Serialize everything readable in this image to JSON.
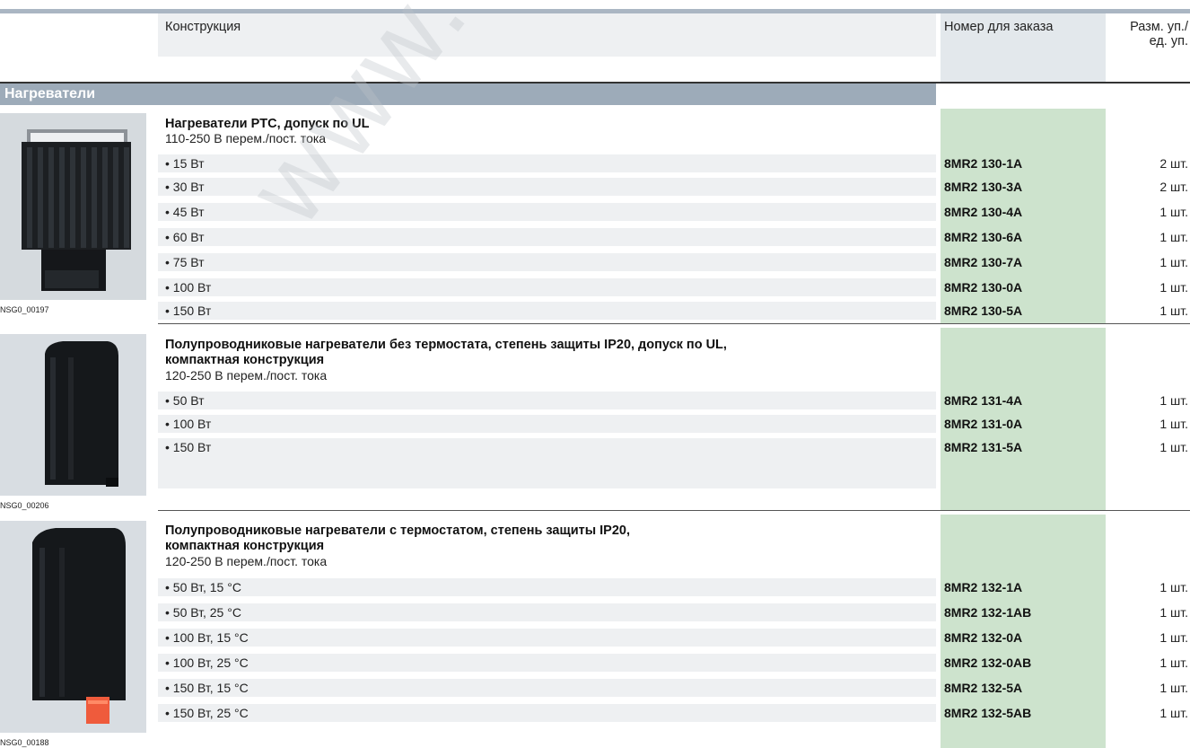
{
  "header": {
    "col_design": "Конструкция",
    "col_order": "Номер для заказа",
    "col_pack_line1": "Разм. уп./",
    "col_pack_line2": "ед. уп."
  },
  "section": {
    "title": "Нагреватели"
  },
  "watermark": "www.TESLI.com",
  "groups": [
    {
      "title_line1": "Нагреватели PTC, допуск по UL",
      "title_line2": "",
      "subtitle": "110-250 В перем./пост. тока",
      "photo_caption": "NSG0_00197",
      "rows": [
        {
          "label": "• 15 Вт",
          "order": "8MR2 130-1A",
          "qty": "2 шт."
        },
        {
          "label": "• 30 Вт",
          "order": "8MR2 130-3A",
          "qty": "2 шт."
        },
        {
          "label": "• 45 Вт",
          "order": "8MR2 130-4A",
          "qty": "1 шт."
        },
        {
          "label": "• 60 Вт",
          "order": "8MR2 130-6A",
          "qty": "1 шт."
        },
        {
          "label": "• 75 Вт",
          "order": "8MR2 130-7A",
          "qty": "1 шт."
        },
        {
          "label": "• 100 Вт",
          "order": "8MR2 130-0A",
          "qty": "1 шт."
        },
        {
          "label": "• 150 Вт",
          "order": "8MR2 130-5A",
          "qty": "1 шт."
        }
      ]
    },
    {
      "title_line1": "Полупроводниковые нагреватели без термостата, степень защиты IP20, допуск по UL,",
      "title_line2": "компактная конструкция",
      "subtitle": "120-250 В перем./пост. тока",
      "photo_caption": "NSG0_00206",
      "rows": [
        {
          "label": "• 50 Вт",
          "order": "8MR2 131-4A",
          "qty": "1 шт."
        },
        {
          "label": "• 100 Вт",
          "order": "8MR2 131-0A",
          "qty": "1 шт."
        },
        {
          "label": "• 150 Вт",
          "order": "8MR2 131-5A",
          "qty": "1 шт."
        }
      ]
    },
    {
      "title_line1": "Полупроводниковые нагреватели с термостатом, степень защиты IP20,",
      "title_line2": "компактная конструкция",
      "subtitle": "120-250 В перем./пост. тока",
      "photo_caption": "NSG0_00188",
      "rows": [
        {
          "label": "• 50 Вт, 15 °C",
          "order": "8MR2 132-1A",
          "qty": "1 шт."
        },
        {
          "label": "• 50 Вт, 25 °C",
          "order": "8MR2 132-1AB",
          "qty": "1 шт."
        },
        {
          "label": "• 100 Вт, 15 °C",
          "order": "8MR2 132-0A",
          "qty": "1 шт."
        },
        {
          "label": "• 100 Вт, 25 °C",
          "order": "8MR2 132-0AB",
          "qty": "1 шт."
        },
        {
          "label": "• 150 Вт, 15 °C",
          "order": "8MR2 132-5A",
          "qty": "1 шт."
        },
        {
          "label": "• 150 Вт, 25 °C",
          "order": "8MR2 132-5AB",
          "qty": "1 шт."
        }
      ]
    }
  ]
}
